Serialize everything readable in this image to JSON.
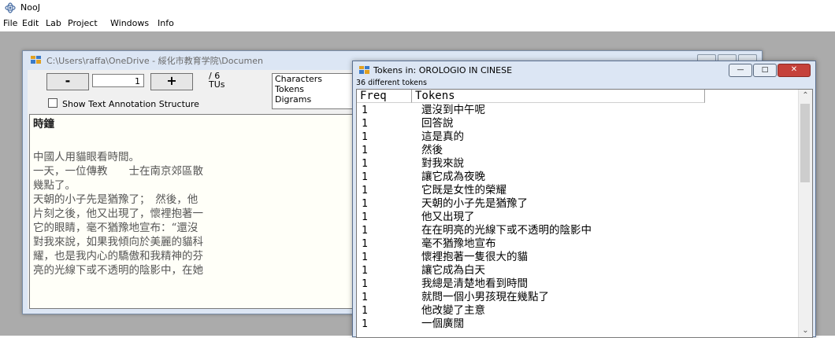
{
  "app": {
    "title": "NooJ"
  },
  "menu": [
    "File",
    "Edit",
    "Lab",
    "Project",
    "Windows",
    "Info"
  ],
  "text_window": {
    "title": "C:\\Users\\raffa\\OneDrive - 綏化市教育学院\\Documen",
    "page_value": "1",
    "page_total": "/ 6",
    "page_unit": "TUs",
    "minus_label": "-",
    "plus_label": "+",
    "stats_list": [
      "Characters",
      "Tokens",
      "Digrams"
    ],
    "annotation_checkbox_label": "Show Text Annotation Structure",
    "annotation_checked": false,
    "lines": [
      "時鐘",
      "",
      "中國人用貓眼看時間。",
      "一天，一位傳教　　士在南京郊區散",
      "幾點了。",
      "天朝的小子先是猶豫了；　然後，他",
      "片刻之後，他又出現了，懷裡抱著一",
      "它的眼睛，毫不猶豫地宣布：“還沒",
      "對我來說，如果我傾向於美麗的貓科",
      "耀，也是我内心的驕傲和我精神的芬",
      "亮的光線下或不透明的陰影中，在她"
    ]
  },
  "tokens_window": {
    "title": "Tokens in: OROLOGIO IN CINESE",
    "count_label": "36 different tokens",
    "columns": [
      "Freq",
      "Tokens"
    ],
    "rows": [
      {
        "freq": "1",
        "token": "還沒到中午呢"
      },
      {
        "freq": "1",
        "token": "回答說"
      },
      {
        "freq": "1",
        "token": "這是真的"
      },
      {
        "freq": "1",
        "token": "然後"
      },
      {
        "freq": "1",
        "token": "對我來說"
      },
      {
        "freq": "1",
        "token": "讓它成為夜晚"
      },
      {
        "freq": "1",
        "token": "它既是女性的榮耀"
      },
      {
        "freq": "1",
        "token": "天朝的小子先是猶豫了"
      },
      {
        "freq": "1",
        "token": "他又出現了"
      },
      {
        "freq": "1",
        "token": "在在明亮的光線下或不透明的陰影中"
      },
      {
        "freq": "1",
        "token": "毫不猶豫地宣布"
      },
      {
        "freq": "1",
        "token": "懷裡抱著一隻很大的貓"
      },
      {
        "freq": "1",
        "token": "讓它成為白天"
      },
      {
        "freq": "1",
        "token": "我總是清楚地看到時間"
      },
      {
        "freq": "1",
        "token": "就問一個小男孩現在幾點了"
      },
      {
        "freq": "1",
        "token": "他改變了主意"
      },
      {
        "freq": "1",
        "token": "一個廣闊"
      }
    ]
  },
  "colors": {
    "mdi_background": "#ababab",
    "window_frame": "#dce6f4",
    "close_button": "#c5413a"
  }
}
